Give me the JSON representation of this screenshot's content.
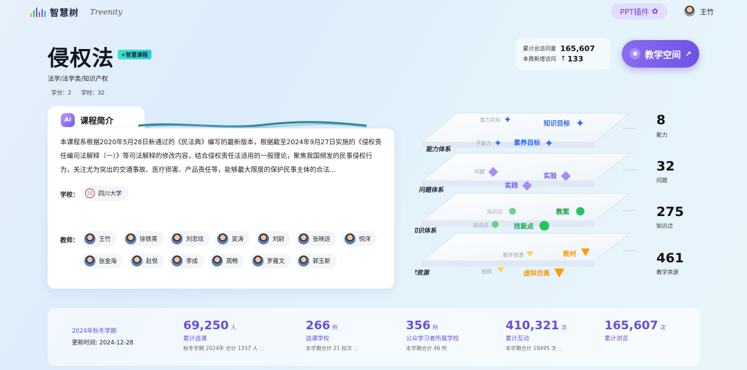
{
  "header": {
    "logo_text": "智慧树",
    "logo_en": "Treenity",
    "ppt_label": "PPT插件",
    "user_name": "王竹"
  },
  "course": {
    "title": "侵权法",
    "badge": "+智慧课程",
    "category": "法学/法学类/知识产权",
    "credit_label": "学分：",
    "credit": "2",
    "hours_label": "学时：",
    "hours": "32"
  },
  "visits": {
    "total_label": "累计总访问量",
    "total": "165,607",
    "week_label": "本周新增访问",
    "week": "133"
  },
  "space_button": "教学空间",
  "intro": {
    "title": "课程简介",
    "ai_label": "AI",
    "description": "本课程系根据2020年5月28日新通过的《民法典》编写的最新版本，根据截至2024年9月27日实施的《侵权责任编司法解释（一）》等司法解释的修改内容，结合侵权责任法适用的一般理论，聚焦我国频发的民事侵权行为，关注尤为突出的交通事故、医疗损害、产品责任等，能够最大限度的保护民事主体的合法...",
    "school_label": "学校：",
    "school": "四川大学",
    "teacher_label": "教师：",
    "teachers": [
      "王竹",
      "徐铁英",
      "刘忠炫",
      "吴涛",
      "刘尉",
      "张晓远",
      "悦洋",
      "张金海",
      "赵悦",
      "李成",
      "周畅",
      "罗雍文",
      "郭玉新"
    ]
  },
  "layers": [
    {
      "name": "能力体系",
      "items": [
        "能力目标",
        "知识目标",
        "子能力",
        "素养目标"
      ]
    },
    {
      "name": "问题体系",
      "items": [
        "问题",
        "实践",
        "实验"
      ]
    },
    {
      "name": "知识体系",
      "items": [
        "知识点",
        "教案",
        "知识点",
        "技能点"
      ]
    },
    {
      "name": "教学资源",
      "items": [
        "教学资源",
        "教材",
        "视频",
        "虚拟仿真"
      ]
    }
  ],
  "stats": [
    {
      "value": "8",
      "label": "能力"
    },
    {
      "value": "32",
      "label": "问题"
    },
    {
      "value": "275",
      "label": "知识点"
    },
    {
      "value": "461",
      "label": "教学资源"
    }
  ],
  "bottom": {
    "term": "2024年秋冬学期",
    "updated": "更新时间:  2024-12-28",
    "items": [
      {
        "value": "69,250",
        "unit": "人",
        "label": "累计选课",
        "sub": "秋冬学期 2024年 合计 1337 人"
      },
      {
        "value": "266",
        "unit": "所",
        "label": "选课学校",
        "sub": "本学期合计 21 校次"
      },
      {
        "value": "356",
        "unit": "所",
        "label": "公众学习者所属学校",
        "sub": "本学期合计 46 所"
      },
      {
        "value": "410,321",
        "unit": "次",
        "label": "累计互动",
        "sub": "本学期合计 19495 次"
      },
      {
        "value": "165,607",
        "unit": "次",
        "label": "累计浏览",
        "sub": ""
      }
    ]
  },
  "colors": {
    "accent": "#6a4ed8",
    "badge": "#2ccde0",
    "blue_icon": "#2f6cf0",
    "purple_icon": "#a98bf5",
    "green_icon": "#22c55e",
    "orange_icon": "#f59e0b"
  }
}
